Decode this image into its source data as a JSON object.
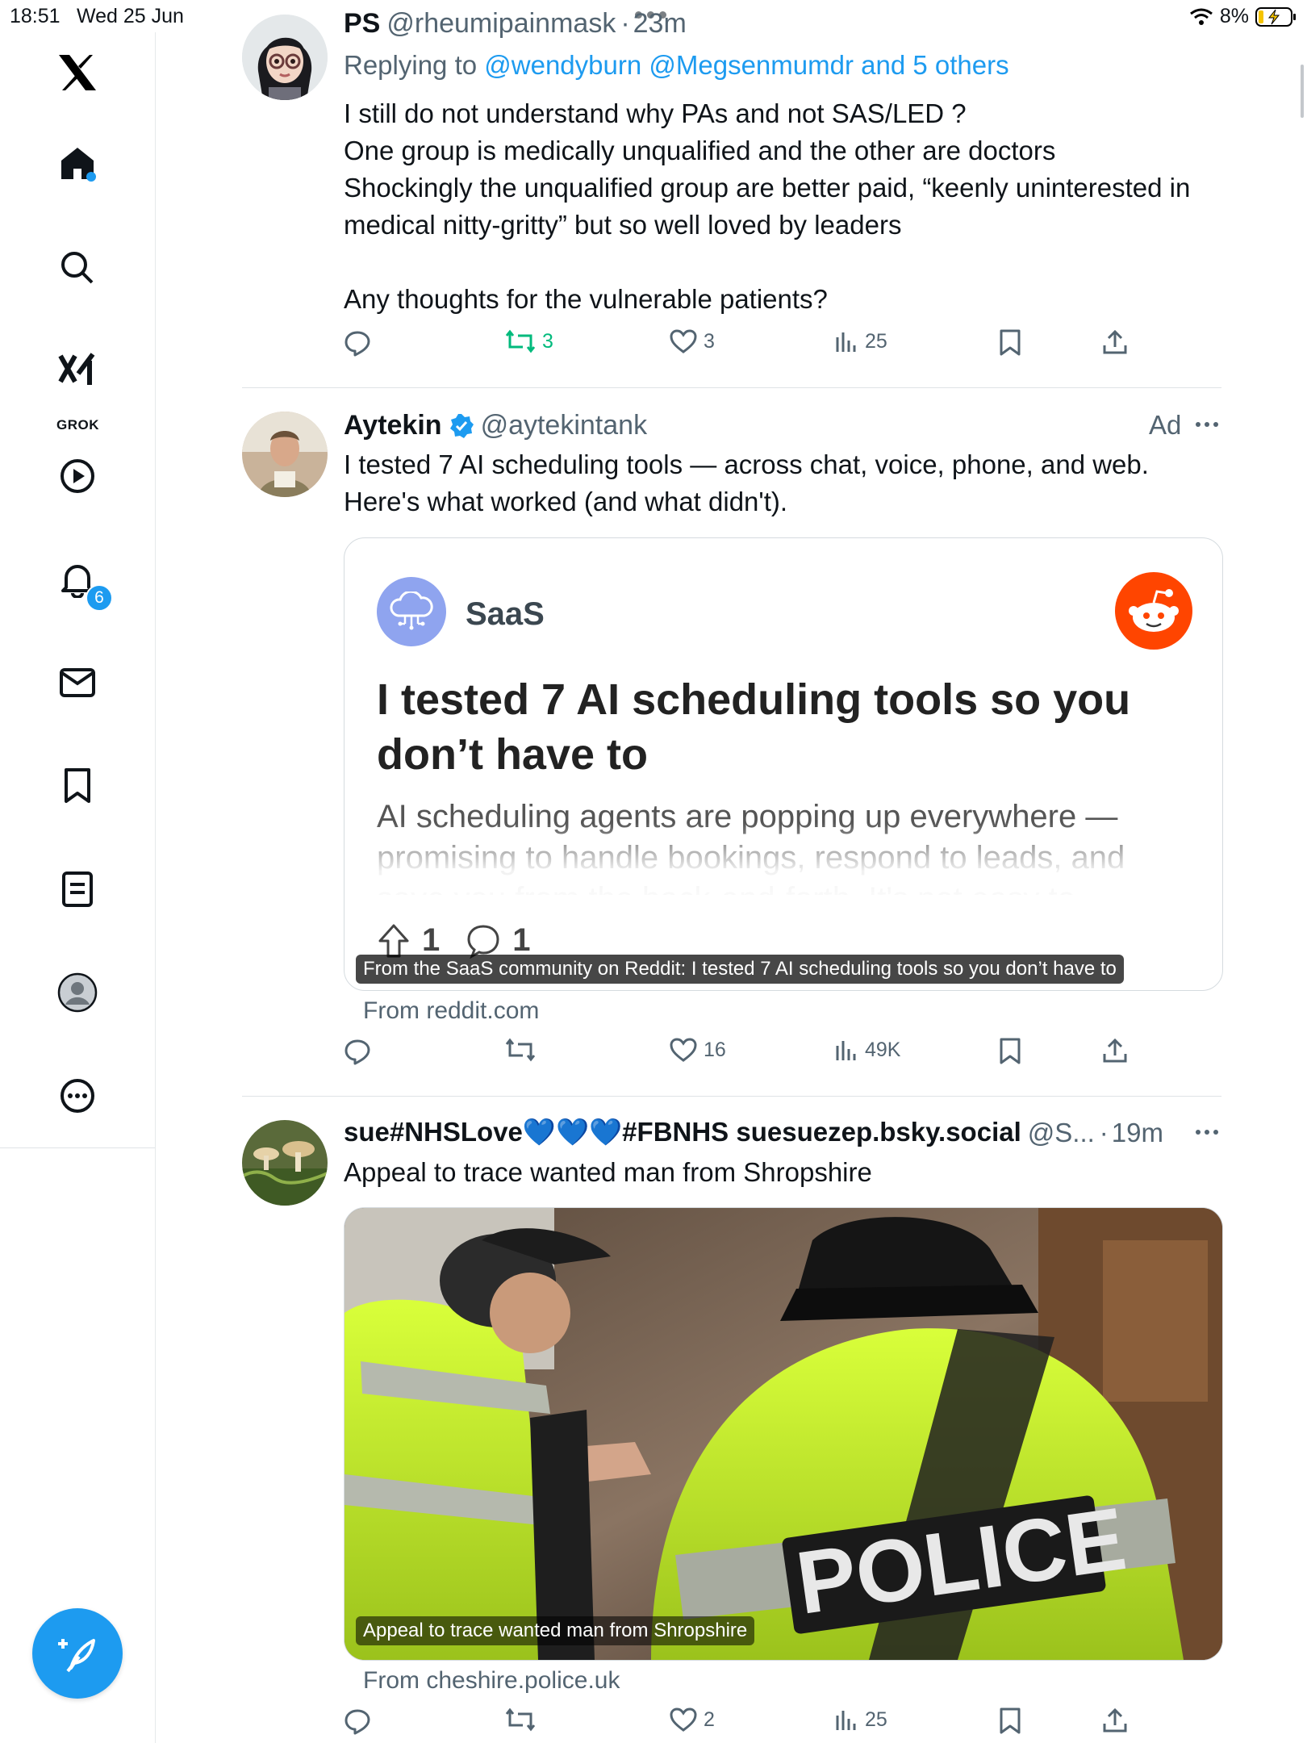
{
  "status_bar": {
    "time": "18:51",
    "date": "Wed 25 Jun",
    "battery": "8%"
  },
  "sidebar": {
    "notifications_badge": "6",
    "grok_label": "GROK",
    "items": [
      "home",
      "explore",
      "grok",
      "videos",
      "notifications",
      "messages",
      "bookmarks",
      "lists",
      "profile",
      "more"
    ]
  },
  "tweets": [
    {
      "name": "PS",
      "handle": "@rheumipainmask",
      "separator": "·",
      "time": "23m",
      "replying_prefix": "Replying to ",
      "replying_to": "@wendyburn @Megsenmumdr and 5 others",
      "text": "I still do not understand why PAs and not SAS/LED ?\nOne group is medically unqualified and the other are doctors\nShockingly the unqualified group are better paid, “keenly uninterested in medical nitty-gritty” but so well loved by leaders\n\nAny thoughts for the vulnerable patients?",
      "reposts": "3",
      "likes": "3",
      "views": "25"
    },
    {
      "name": "Aytekin",
      "handle": "@aytekintank",
      "ad_label": "Ad",
      "text": "I tested 7 AI scheduling tools — across chat, voice, phone, and web. Here's what worked (and what didn't).",
      "card": {
        "community": "SaaS",
        "title": "I tested 7 AI scheduling tools so you don’t have to",
        "description": "AI scheduling agents are popping up everywhere — promising to handle bookings, respond to leads, and save you from the back-and-forth. It's not easy to",
        "upvotes": "1",
        "comments": "1",
        "caption": "From the SaaS community on Reddit: I tested 7 AI scheduling tools so you don’t have to"
      },
      "source": "From reddit.com",
      "likes": "16",
      "views": "49K"
    },
    {
      "name": "sue#NHSLove💙💙💙#FBNHS suesuezep.bsky.social",
      "handle": "@S...",
      "separator": "·",
      "time": "19m",
      "text": "Appeal to trace wanted man from Shropshire",
      "media_caption": "Appeal to trace wanted man from Shropshire",
      "media_text": "POLICE",
      "source": "From cheshire.police.uk",
      "likes": "2",
      "views": "25"
    }
  ],
  "colors": {
    "accent": "#1d9bf0",
    "retweet_green": "#00ba7c",
    "secondary_text": "#536471",
    "reddit": "#ff4500"
  }
}
